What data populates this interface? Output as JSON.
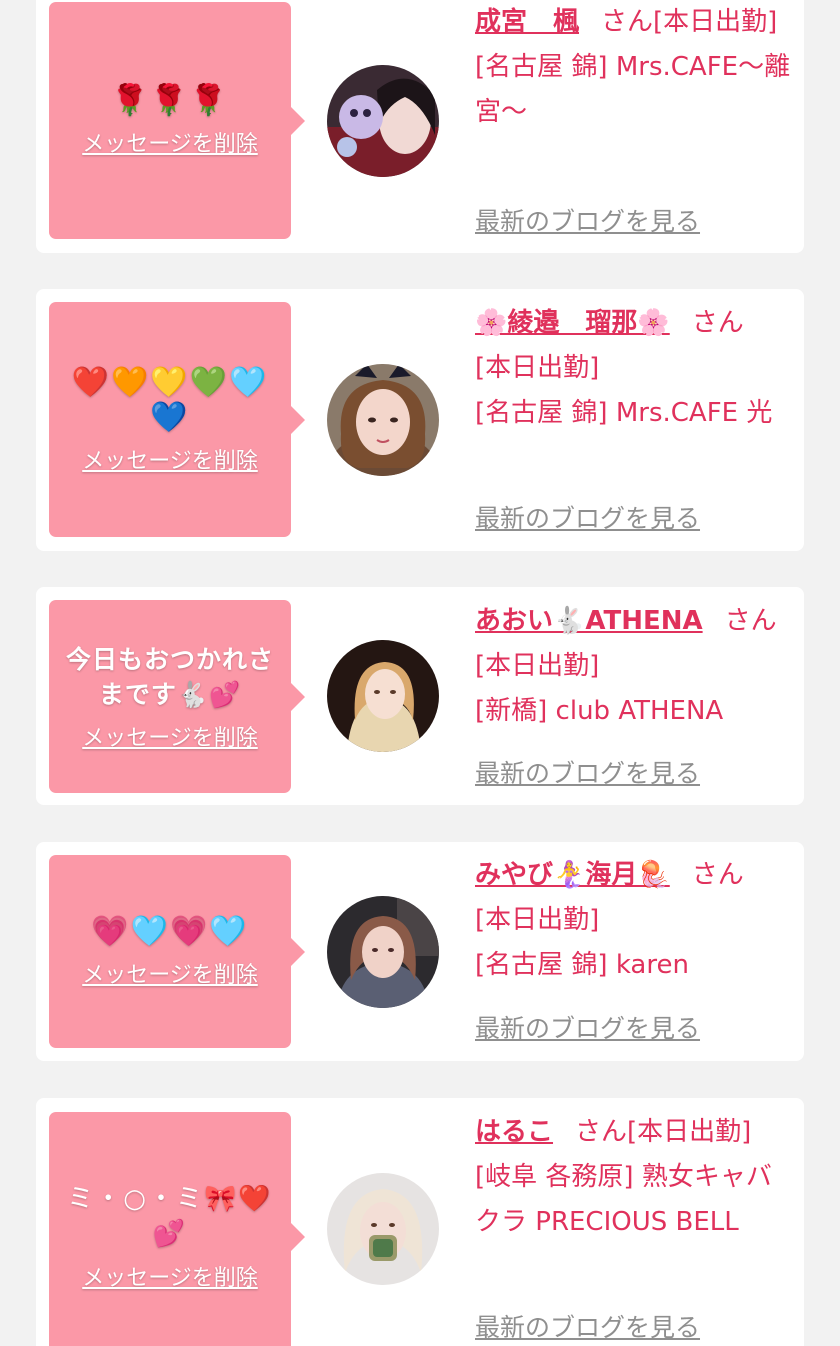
{
  "colors": {
    "background": "#f2f2f2",
    "card": "#ffffff",
    "bubble": "#fb98a7",
    "accent": "#e0315c",
    "link_gray": "#8f8f8f"
  },
  "cards": [
    {
      "message": "🌹🌹🌹",
      "delete_label": "メッセージを削除",
      "name": "成宮　楓",
      "honorific": "さん",
      "status": "[本日出勤]",
      "shop": "[名古屋 錦] Mrs.CAFE〜離宮〜",
      "blog_label": "最新のブログを見る",
      "avatar_icon": "profile-photo"
    },
    {
      "message": "❤️🧡💛💚🩵💙",
      "delete_label": "メッセージを削除",
      "name": "🌸綾邉　瑠那🌸",
      "honorific": "さん",
      "status": "[本日出勤]",
      "shop": "[名古屋 錦] Mrs.CAFE 光",
      "blog_label": "最新のブログを見る",
      "avatar_icon": "profile-photo"
    },
    {
      "message": "今日もおつかれさまです🐇💕",
      "delete_label": "メッセージを削除",
      "name": "あおい🐇ATHENA",
      "honorific": "さん",
      "status": "[本日出勤]",
      "shop": "[新橋] club ATHENA",
      "blog_label": "最新のブログを見る",
      "avatar_icon": "profile-photo"
    },
    {
      "message": "💗🩵💗🩵",
      "delete_label": "メッセージを削除",
      "name": "みやび🧜‍♀️海月🪼",
      "honorific": "さん",
      "status": "[本日出勤]",
      "shop": "[名古屋 錦] karen",
      "blog_label": "最新のブログを見る",
      "avatar_icon": "profile-photo"
    },
    {
      "message": "ミ・○・ミ🎀❤️💕",
      "delete_label": "メッセージを削除",
      "name": "はるこ",
      "honorific": "さん",
      "status": "[本日出勤]",
      "shop": "[岐阜 各務原]  熟女キャバクラ PRECIOUS BELL",
      "blog_label": "最新のブログを見る",
      "avatar_icon": "profile-photo"
    }
  ]
}
